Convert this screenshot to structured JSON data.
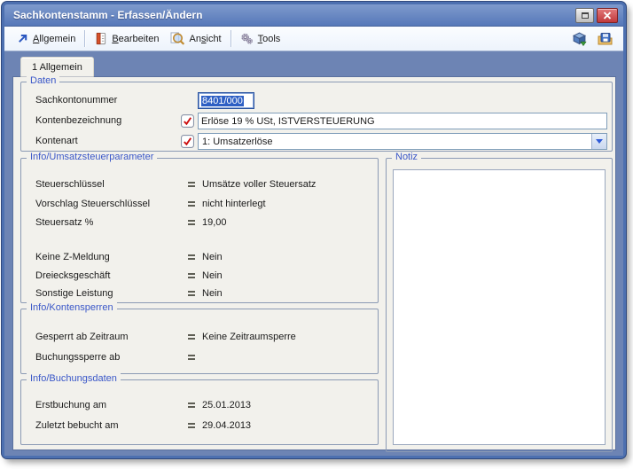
{
  "window": {
    "title": "Sachkontenstamm - Erfassen/Ändern"
  },
  "colors": {
    "titlebar-top": "#7e9acc",
    "titlebar-bottom": "#5678b9",
    "frame": "#4d70b0",
    "desktop": "#6d84b4",
    "panel": "#f2f1ec",
    "legend": "#3a57c8",
    "selection": "#2e5fc4",
    "close-red": "#c0393c",
    "toolbar": "#edf3fc"
  },
  "menubar": {
    "items": [
      {
        "label": "Allgemein",
        "accel": 0,
        "icon": "arrow-up-right-icon"
      },
      {
        "label": "Bearbeiten",
        "accel": 0,
        "icon": "notebook-icon"
      },
      {
        "label": "Ansicht",
        "accel": 2,
        "icon": "magnifier-icon"
      },
      {
        "label": "Tools",
        "accel": 0,
        "icon": "gears-icon"
      }
    ]
  },
  "tabs": [
    {
      "label": "1 Allgemein"
    }
  ],
  "daten": {
    "legend": "Daten",
    "sachkontonummer": {
      "label": "Sachkontonummer",
      "value": "8401/000"
    },
    "kontenbezeichnung": {
      "label": "Kontenbezeichnung",
      "value": "Erlöse 19 % USt, ISTVERSTEUERUNG"
    },
    "kontenart": {
      "label": "Kontenart",
      "value": "1: Umsatzerlöse"
    }
  },
  "ust": {
    "legend": "Info/Umsatzsteuerparameter",
    "rows": [
      {
        "label": "Steuerschlüssel",
        "value": "Umsätze voller Steuersatz"
      },
      {
        "label": "Vorschlag Steuerschlüssel",
        "value": "nicht hinterlegt"
      },
      {
        "label": "Steuersatz %",
        "value": "19,00"
      },
      {
        "label": "Keine Z-Meldung",
        "value": "Nein"
      },
      {
        "label": "Dreiecksgeschäft",
        "value": "Nein"
      },
      {
        "label": "Sonstige Leistung",
        "value": "Nein"
      }
    ]
  },
  "notiz": {
    "legend": "Notiz",
    "value": ""
  },
  "sperren": {
    "legend": "Info/Kontensperren",
    "rows": [
      {
        "label": "Gesperrt ab Zeitraum",
        "value": "Keine Zeitraumsperre"
      },
      {
        "label": "Buchungssperre ab",
        "value": ""
      }
    ]
  },
  "buchung": {
    "legend": "Info/Buchungsdaten",
    "rows": [
      {
        "label": "Erstbuchung am",
        "value": "25.01.2013"
      },
      {
        "label": "Zuletzt bebucht am",
        "value": "29.04.2013"
      }
    ]
  }
}
